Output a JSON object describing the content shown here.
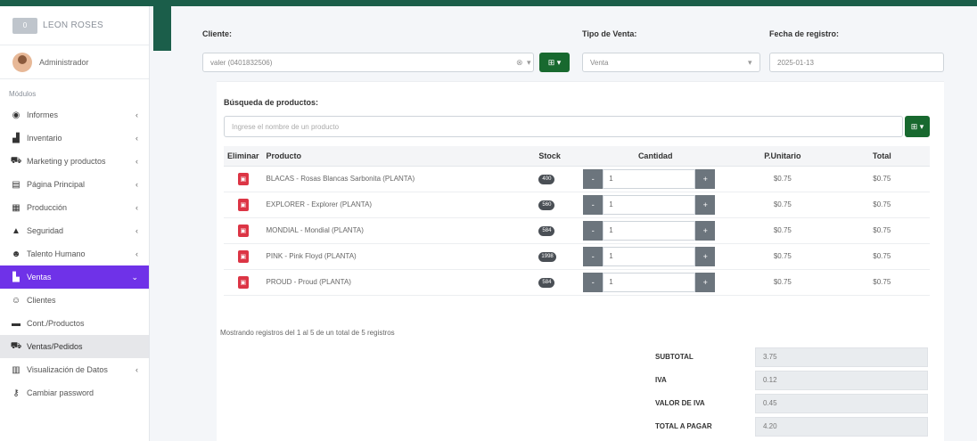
{
  "sidebar": {
    "brand": {
      "logo_text": "0",
      "name": "LEON ROSES"
    },
    "user": {
      "name": "Administrador"
    },
    "section_label": "Módulos",
    "items": [
      {
        "label": "Informes",
        "icon": "globe-icon",
        "glyph": "◉",
        "chevron": "‹"
      },
      {
        "label": "Inventario",
        "icon": "boxes-icon",
        "glyph": "▟",
        "chevron": "‹"
      },
      {
        "label": "Marketing y productos",
        "icon": "cart-icon",
        "glyph": "⛟",
        "chevron": "‹"
      },
      {
        "label": "Página Principal",
        "icon": "page-icon",
        "glyph": "▤",
        "chevron": "‹"
      },
      {
        "label": "Producción",
        "icon": "calendar-icon",
        "glyph": "▦",
        "chevron": "‹"
      },
      {
        "label": "Seguridad",
        "icon": "lock-icon",
        "glyph": "▲",
        "chevron": "‹"
      },
      {
        "label": "Talento Humano",
        "icon": "users-icon",
        "glyph": "☻",
        "chevron": "‹"
      },
      {
        "label": "Ventas",
        "icon": "store-icon",
        "glyph": "▙",
        "chevron": "⌄"
      }
    ],
    "sub_items": [
      {
        "label": "Clientes",
        "icon": "user-plus-icon",
        "glyph": "☺"
      },
      {
        "label": "Cont./Productos",
        "icon": "list-icon",
        "glyph": "▬"
      },
      {
        "label": "Ventas/Pedidos",
        "icon": "cart-icon",
        "glyph": "⛟"
      },
      {
        "label": "Visualización de Datos",
        "icon": "chart-icon",
        "glyph": "▥",
        "chevron": "‹"
      },
      {
        "label": "Cambiar password",
        "icon": "key-icon",
        "glyph": "⚷"
      }
    ]
  },
  "form": {
    "client_label": "Cliente:",
    "client_value": "valer (0401832506)",
    "client_clear": "⊗",
    "client_caret": "▾",
    "client_btn": "⊞ ▾",
    "sale_type_label": "Tipo de Venta:",
    "sale_type_value": "Venta",
    "sale_type_caret": "▾",
    "date_label": "Fecha de registro:",
    "date_value": "2025-01-13"
  },
  "search": {
    "label": "Búsqueda de productos:",
    "placeholder": "Ingrese el nombre de un producto",
    "btn": "⊞ ▾"
  },
  "table": {
    "headers": [
      "Eliminar",
      "Producto",
      "Stock",
      "Cantidad",
      "P.Unitario",
      "Total"
    ],
    "rows": [
      {
        "product": "BLACAS - Rosas Blancas Sarbonita (PLANTA)",
        "stock": "400",
        "qty": "1",
        "unit": "$0.75",
        "total": "$0.75"
      },
      {
        "product": "EXPLORER - Explorer (PLANTA)",
        "stock": "560",
        "qty": "1",
        "unit": "$0.75",
        "total": "$0.75"
      },
      {
        "product": "MONDIAL - Mondial (PLANTA)",
        "stock": "584",
        "qty": "1",
        "unit": "$0.75",
        "total": "$0.75"
      },
      {
        "product": "PINK - Pink Floyd (PLANTA)",
        "stock": "1998",
        "qty": "1",
        "unit": "$0.75",
        "total": "$0.75"
      },
      {
        "product": "PROUD - Proud (PLANTA)",
        "stock": "584",
        "qty": "1",
        "unit": "$0.75",
        "total": "$0.75"
      }
    ],
    "delete_glyph": "▣",
    "minus_glyph": "-",
    "plus_glyph": "+"
  },
  "records_text": "Mostrando registros del 1 al 5 de un total de 5 registros",
  "totals": [
    {
      "label": "SUBTOTAL",
      "value": "3.75"
    },
    {
      "label": "IVA",
      "value": "0.12"
    },
    {
      "label": "VALOR DE IVA",
      "value": "0.45"
    },
    {
      "label": "TOTAL A PAGAR",
      "value": "4.20"
    }
  ],
  "colors": {
    "brand_green": "#1b5e4a",
    "button_green": "#18692f",
    "active_purple": "#6f32e8",
    "danger": "#dc3545"
  }
}
